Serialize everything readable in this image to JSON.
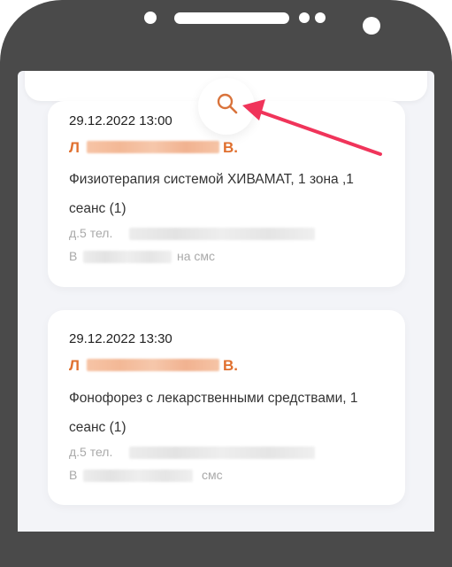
{
  "appointments": [
    {
      "datetime": "29.12.2022 13:00",
      "name_first": "Л",
      "name_last": "В.",
      "service": "Физиотерапия системой ХИВАМАТ, 1 зона ,1 сеанс (1)",
      "address_prefix": "д.5 тел.",
      "note_prefix": "В",
      "note_suffix": "на смс"
    },
    {
      "datetime": "29.12.2022 13:30",
      "name_first": "Л",
      "name_last": "В.",
      "service": "Фонофорез с лекарственными средствами, 1 сеанс (1)",
      "address_prefix": "д.5 тел.",
      "note_prefix": "В",
      "note_suffix": "смс"
    }
  ],
  "colors": {
    "accent": "#e0702f",
    "arrow": "#f0345a",
    "frame": "#4a4a4a"
  },
  "icons": {
    "search": "search-icon"
  }
}
